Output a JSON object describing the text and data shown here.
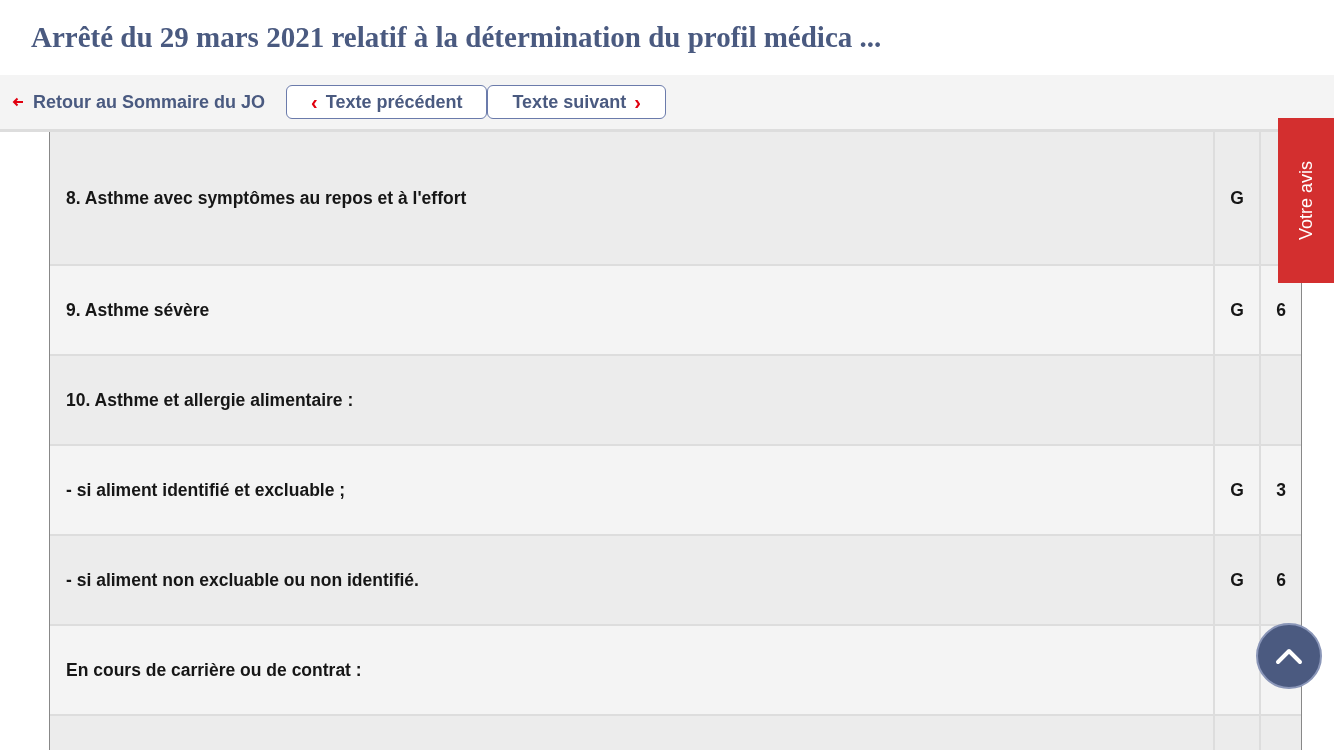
{
  "page_title": "Arrêté du 29 mars 2021 relatif à la détermination du profil médica ...",
  "nav": {
    "back_link": "Retour au Sommaire du JO",
    "previous_chevron": "‹",
    "previous_button": "Texte précédent",
    "next_button": "Texte suivant",
    "next_chevron": "›"
  },
  "table": {
    "rows": [
      {
        "cells": [
          "8. Asthme avec symptômes au repos et à l'effort",
          "G"
        ],
        "tall": true
      },
      {
        "cells": [
          "9. Asthme sévère",
          "G",
          "6"
        ],
        "tall": false
      },
      {
        "cells": [
          "10. Asthme et allergie alimentaire :"
        ],
        "tall": false
      },
      {
        "cells": [
          "- si aliment identifié et excluable ;",
          "G",
          "3"
        ],
        "tall": false
      },
      {
        "cells": [
          "- si aliment non excluable ou non identifié.",
          "G",
          "6"
        ],
        "tall": false
      },
      {
        "cells": [
          "En cours de carrière ou de contrat :"
        ],
        "tall": false
      }
    ]
  },
  "feedback_tab": "Votre avis"
}
